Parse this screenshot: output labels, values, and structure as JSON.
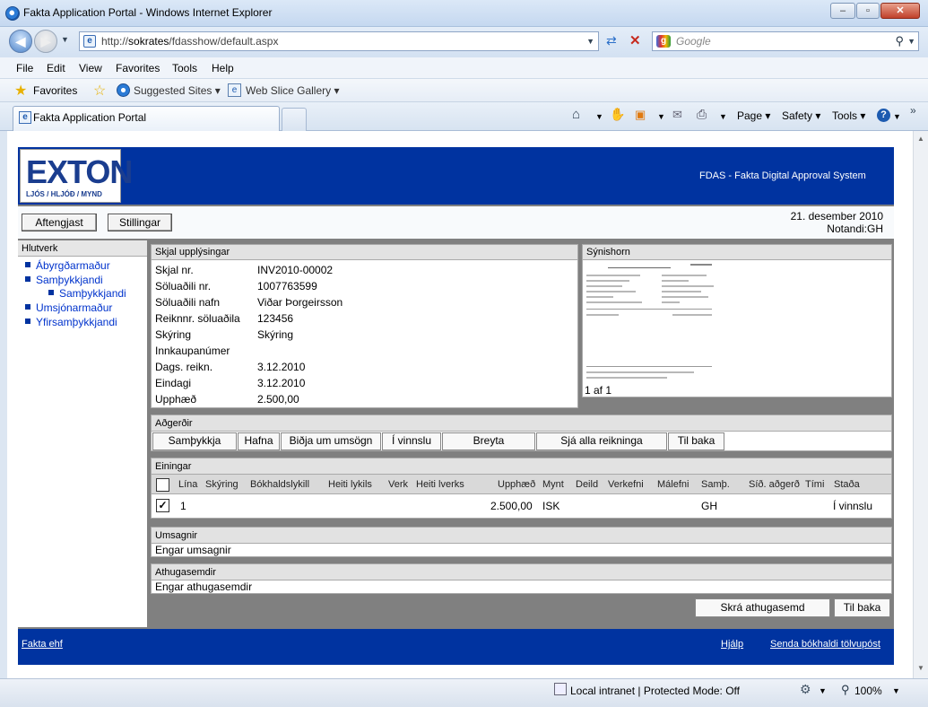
{
  "browser": {
    "window_title": "Fakta Application Portal - Windows Internet Explorer",
    "url_prefix": "http://",
    "url_host": "sokrates",
    "url_path": "/fdasshow/default.aspx",
    "search_placeholder": "Google",
    "menu": [
      "File",
      "Edit",
      "View",
      "Favorites",
      "Tools",
      "Help"
    ],
    "favorites_label": "Favorites",
    "fav_links": [
      "Suggested Sites ▾",
      "Web Slice Gallery ▾"
    ],
    "tab_title": "Fakta Application Portal",
    "commands": [
      "Page ▾",
      "Safety ▾",
      "Tools ▾"
    ],
    "status_zone": "Local intranet | Protected Mode: Off",
    "zoom": "100%"
  },
  "app": {
    "logo_big": "EXTON",
    "logo_small": "LJÓS / HLJÓÐ / MYND",
    "system_title": "FDAS - Fakta Digital Approval System",
    "logout_label": "Aftengjast",
    "settings_label": "Stillingar",
    "date": "21. desember 2010",
    "user": "Notandi:GH"
  },
  "sidebar": {
    "header": "Hlutverk",
    "items": [
      "Ábyrgðarmaður",
      "Samþykkjandi",
      "Samþykkjandi",
      "Umsjónarmaður",
      "Yfirsamþykkjandi"
    ]
  },
  "document": {
    "header": "Skjal upplýsingar",
    "fields": [
      {
        "label": "Skjal nr.",
        "value": "INV2010-00002"
      },
      {
        "label": "Söluaðili nr.",
        "value": "1007763599"
      },
      {
        "label": "Söluaðili nafn",
        "value": "Viðar Þorgeirsson"
      },
      {
        "label": "Reiknnr. söluaðila",
        "value": "123456"
      },
      {
        "label": "Skýring",
        "value": "Skýring"
      },
      {
        "label": "Innkaupanúmer",
        "value": ""
      },
      {
        "label": "Dags. reikn.",
        "value": "3.12.2010"
      },
      {
        "label": "Eindagi",
        "value": "3.12.2010"
      },
      {
        "label": "Upphæð",
        "value": "2.500,00"
      }
    ]
  },
  "preview": {
    "header": "Sýnishorn",
    "page_indicator": "1 af 1"
  },
  "actions": {
    "header": "Aðgerðir",
    "buttons": [
      "Samþykkja",
      "Hafna",
      "Biðja um umsögn",
      "Í vinnslu",
      "Breyta",
      "Sjá alla reikninga",
      "Til baka"
    ]
  },
  "lines": {
    "header": "Einingar",
    "columns": [
      "Lína",
      "Skýring",
      "Bókhaldslykill",
      "Heiti lykils",
      "Verk",
      "Heiti lverks",
      "Upphæð",
      "Mynt",
      "Deild",
      "Verkefni",
      "Málefni",
      "Samþ.",
      "Síð. aðgerð",
      "Tími",
      "Staða"
    ],
    "rows": [
      {
        "line": "1",
        "amount": "2.500,00",
        "currency": "ISK",
        "approver": "GH",
        "status": "Í vinnslu"
      }
    ]
  },
  "reviews": {
    "header": "Umsagnir",
    "text": "Engar umsagnir"
  },
  "comments": {
    "header": "Athugasemdir",
    "text": "Engar athugasemdir",
    "add_label": "Skrá athugasemd",
    "back_label": "Til baka"
  },
  "footer": {
    "company": "Fakta ehf",
    "help": "Hjálp",
    "email": "Senda bókhaldi tölvupóst"
  },
  "colors": {
    "app_blue": "#0033a0",
    "link_blue": "#0033cc",
    "panel_grey": "#808080"
  }
}
